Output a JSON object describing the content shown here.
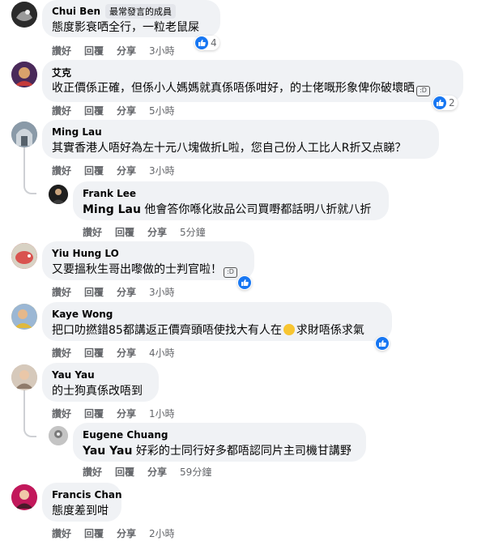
{
  "actions": {
    "like": "讚好",
    "reply": "回覆",
    "share": "分享"
  },
  "comments": [
    {
      "author": "Chui Ben",
      "badge": "最常發言的成員",
      "text": "態度影衰哂全行，一粒老鼠屎",
      "time": "3小時",
      "reaction_count": "4",
      "avatar": "chui-ben-avatar"
    },
    {
      "author": "艾克",
      "text": "收正價係正確，但係小人媽媽就真係唔係咁好，的士佬嘅形象俾你破壞晒",
      "time": "5小時",
      "reaction_count": "2",
      "avatar": "ai-ke-avatar"
    },
    {
      "author": "Ming Lau",
      "text": "其實香港人唔好為左十元八塊做折L啦，您自己份人工比人R折又点睇？",
      "time": "3小時",
      "avatar": "ming-lau-avatar"
    },
    {
      "author": "Frank Lee",
      "mention": "Ming Lau",
      "text": "他會答你喺化妝品公司買嘢都話明八折就八折",
      "time": "5分鐘",
      "avatar": "frank-lee-avatar"
    },
    {
      "author": "Yiu Hung LO",
      "text": "又要搵秋生哥出嚟做的士判官啦！",
      "time": "3小時",
      "avatar": "yiu-hung-lo-avatar"
    },
    {
      "author": "Kaye Wong",
      "text_before_emoji": "把口叻撚錯85都講返正價齊頭唔使找大有人在",
      "text_after_emoji": "求財唔係求氣",
      "time": "4小時",
      "avatar": "kaye-wong-avatar"
    },
    {
      "author": "Yau Yau",
      "text": "的士狗真係改唔到",
      "time": "1小時",
      "avatar": "yau-yau-avatar"
    },
    {
      "author": "Eugene Chuang",
      "mention": "Yau Yau",
      "text": "好彩的士同行好多都唔認同片主司機甘講野",
      "time": "59分鐘",
      "avatar": "eugene-chuang-avatar"
    },
    {
      "author": "Francis Chan",
      "text": "態度差到咁",
      "time": "2小時",
      "avatar": "francis-chan-avatar"
    }
  ],
  "colors": {
    "bubble": "#f0f2f5",
    "meta": "#65676b",
    "like_blue": "#1877f2",
    "thread_line": "#ced0d4"
  }
}
